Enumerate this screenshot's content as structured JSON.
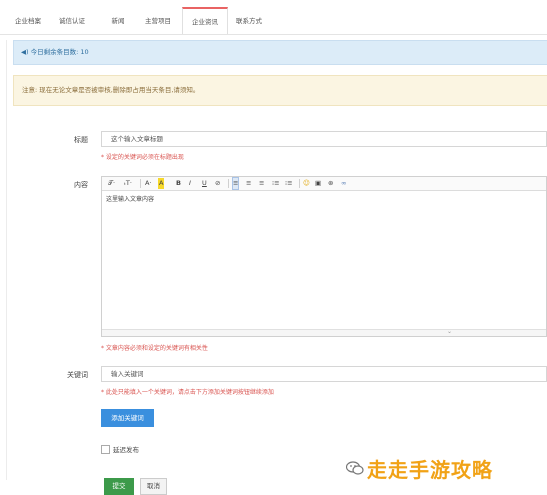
{
  "tabs": [
    "企业档案",
    "诚信认证",
    "新闻",
    "主营项目",
    "企业资讯",
    "联系方式"
  ],
  "info_bar": {
    "text": "◀) 今日剩余条目数: 10"
  },
  "notice_bar": {
    "text": "注意: 现在无论文章是否被审核,删除即占用当天条目,请须知。"
  },
  "form": {
    "title_label": "标题",
    "title_value": "这个输入文章标题",
    "title_hint": "* 设定的关键词必须在标题出现",
    "content_label": "内容",
    "editor_toolbar": [
      "𝒯· ",
      "ₜT·",
      "A·",
      "A",
      "B",
      "I",
      "U",
      "⊘",
      "≡",
      "≡",
      "≡",
      "⁝≡",
      "⁝≡",
      "☺",
      "▣",
      "⊛",
      "∞"
    ],
    "content_value": "这里输入文章内容",
    "resize_glyph": "⌄",
    "content_hint": "* 文章内容必须和设定的关键词有相关性",
    "keyword_label": "关键词",
    "keyword_value": "输入关键词",
    "keyword_hint": "* 此处只能填入一个关键词，请点击下方添加关键词按钮继续添加",
    "add_keyword_button": "添加关键词",
    "delay_publish_label": "延迟发布",
    "submit_button": "提交",
    "cancel_button": "取消"
  },
  "watermark": {
    "text": "走走手游攻略"
  },
  "colors": {
    "tab_active": "#e96363",
    "info_bg": "#dcecf8",
    "notice_bg": "#fbf5e2",
    "hint": "#d9534f",
    "primary_button": "#3a8fde",
    "submit_button": "#3c9a4a",
    "watermark": "#f1a216"
  }
}
